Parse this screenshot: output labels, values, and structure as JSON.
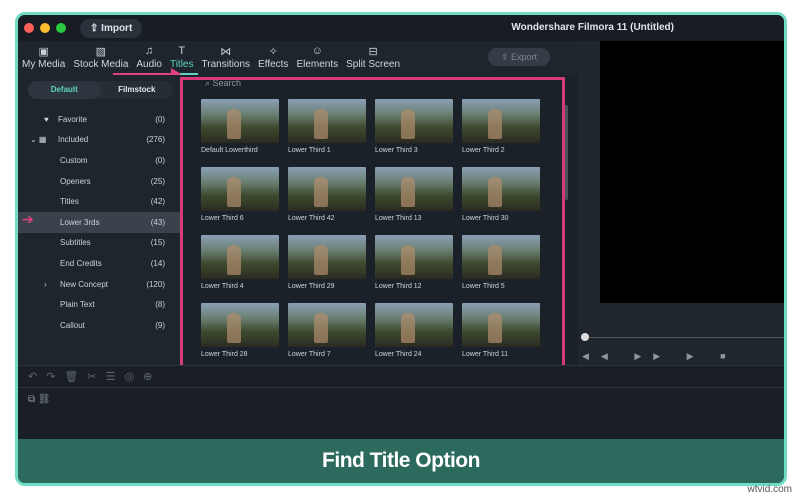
{
  "window": {
    "title": "Wondershare Filmora 11 (Untitled)",
    "import_label": "Import",
    "export_label": "Export"
  },
  "tabs": [
    {
      "label": "My Media",
      "icon": "image-icon"
    },
    {
      "label": "Stock Media",
      "icon": "stock-icon"
    },
    {
      "label": "Audio",
      "icon": "music-icon"
    },
    {
      "label": "Titles",
      "icon": "titles-icon",
      "active": true
    },
    {
      "label": "Transitions",
      "icon": "transition-icon"
    },
    {
      "label": "Effects",
      "icon": "effects-icon"
    },
    {
      "label": "Elements",
      "icon": "elements-icon"
    },
    {
      "label": "Split Screen",
      "icon": "split-screen-icon"
    }
  ],
  "sidebar": {
    "segments": [
      "Default",
      "Filmstock"
    ],
    "items": [
      {
        "label": "Favorite",
        "count": "(0)"
      },
      {
        "label": "Included",
        "count": "(276)"
      },
      {
        "label": "Custom",
        "count": "(0)"
      },
      {
        "label": "Openers",
        "count": "(25)"
      },
      {
        "label": "Titles",
        "count": "(42)"
      },
      {
        "label": "Lower 3rds",
        "count": "(43)"
      },
      {
        "label": "Subtitles",
        "count": "(15)"
      },
      {
        "label": "End Credits",
        "count": "(14)"
      },
      {
        "label": "New Concept",
        "count": "(120)"
      },
      {
        "label": "Plain Text",
        "count": "(8)"
      },
      {
        "label": "Callout",
        "count": "(9)"
      }
    ]
  },
  "search": {
    "placeholder": "Search"
  },
  "titles": [
    "Default Lowerthird",
    "Lower Third 1",
    "Lower Third 3",
    "Lower Third 2",
    "Lower Third 6",
    "Lower Third 42",
    "Lower Third 13",
    "Lower Third 30",
    "Lower Third 4",
    "Lower Third 29",
    "Lower Third 12",
    "Lower Third 5",
    "Lower Third 28",
    "Lower Third 7",
    "Lower Third 24",
    "Lower Third 11"
  ],
  "caption": "Find Title Option",
  "watermark": "wtvid.com",
  "colors": {
    "accent": "#5fd4c0",
    "highlight": "#d63a78",
    "frame": "#6fdcc3",
    "caption_bg": "#2c6a5e"
  }
}
